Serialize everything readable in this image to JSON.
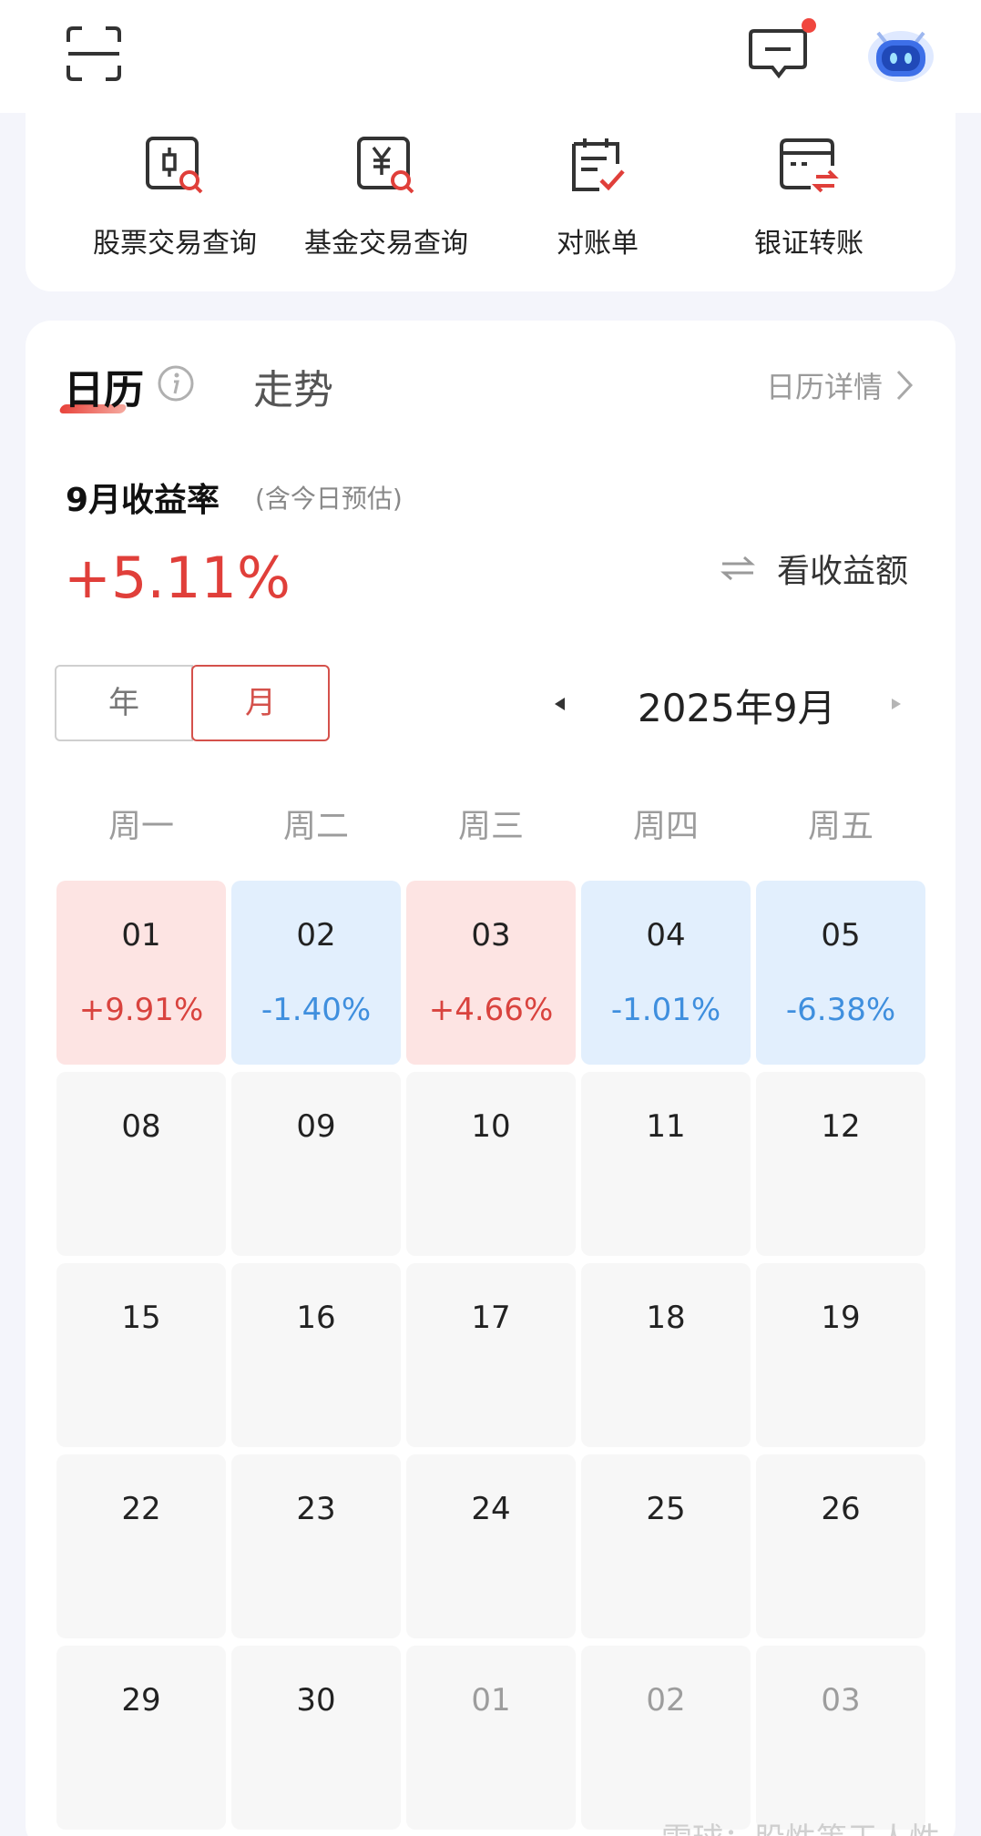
{
  "quick_actions": [
    {
      "label": "股票交易查询",
      "icon": "stock-search-icon"
    },
    {
      "label": "基金交易查询",
      "icon": "fund-search-icon"
    },
    {
      "label": "对账单",
      "icon": "statement-icon"
    },
    {
      "label": "银证转账",
      "icon": "bank-transfer-icon"
    }
  ],
  "tabs": {
    "calendar": "日历",
    "trend": "走势"
  },
  "detail_link": "日历详情",
  "rate": {
    "title": "9月收益率",
    "note": "(含今日预估)",
    "value": "+5.11%",
    "toggle_label": "看收益额"
  },
  "period": {
    "year": "年",
    "month": "月",
    "current": "2025年9月"
  },
  "weekdays": [
    "周一",
    "周二",
    "周三",
    "周四",
    "周五"
  ],
  "calendar": [
    [
      {
        "day": "01",
        "pct": "+9.91%",
        "trend": "up"
      },
      {
        "day": "02",
        "pct": "-1.40%",
        "trend": "down"
      },
      {
        "day": "03",
        "pct": "+4.66%",
        "trend": "up"
      },
      {
        "day": "04",
        "pct": "-1.01%",
        "trend": "down"
      },
      {
        "day": "05",
        "pct": "-6.38%",
        "trend": "down"
      }
    ],
    [
      {
        "day": "08",
        "pct": "",
        "trend": "none"
      },
      {
        "day": "09",
        "pct": "",
        "trend": "none"
      },
      {
        "day": "10",
        "pct": "",
        "trend": "none"
      },
      {
        "day": "11",
        "pct": "",
        "trend": "none"
      },
      {
        "day": "12",
        "pct": "",
        "trend": "none"
      }
    ],
    [
      {
        "day": "15",
        "pct": "",
        "trend": "none"
      },
      {
        "day": "16",
        "pct": "",
        "trend": "none"
      },
      {
        "day": "17",
        "pct": "",
        "trend": "none"
      },
      {
        "day": "18",
        "pct": "",
        "trend": "none"
      },
      {
        "day": "19",
        "pct": "",
        "trend": "none"
      }
    ],
    [
      {
        "day": "22",
        "pct": "",
        "trend": "none"
      },
      {
        "day": "23",
        "pct": "",
        "trend": "none"
      },
      {
        "day": "24",
        "pct": "",
        "trend": "none"
      },
      {
        "day": "25",
        "pct": "",
        "trend": "none"
      },
      {
        "day": "26",
        "pct": "",
        "trend": "none"
      }
    ],
    [
      {
        "day": "29",
        "pct": "",
        "trend": "none"
      },
      {
        "day": "30",
        "pct": "",
        "trend": "none"
      },
      {
        "day": "01",
        "pct": "",
        "trend": "other"
      },
      {
        "day": "02",
        "pct": "",
        "trend": "other"
      },
      {
        "day": "03",
        "pct": "",
        "trend": "other"
      }
    ]
  ],
  "watermark": "雪球：股性等于人性",
  "colors": {
    "up": "#d9433e",
    "down": "#3f8fde",
    "accent": "#e03f3a"
  }
}
